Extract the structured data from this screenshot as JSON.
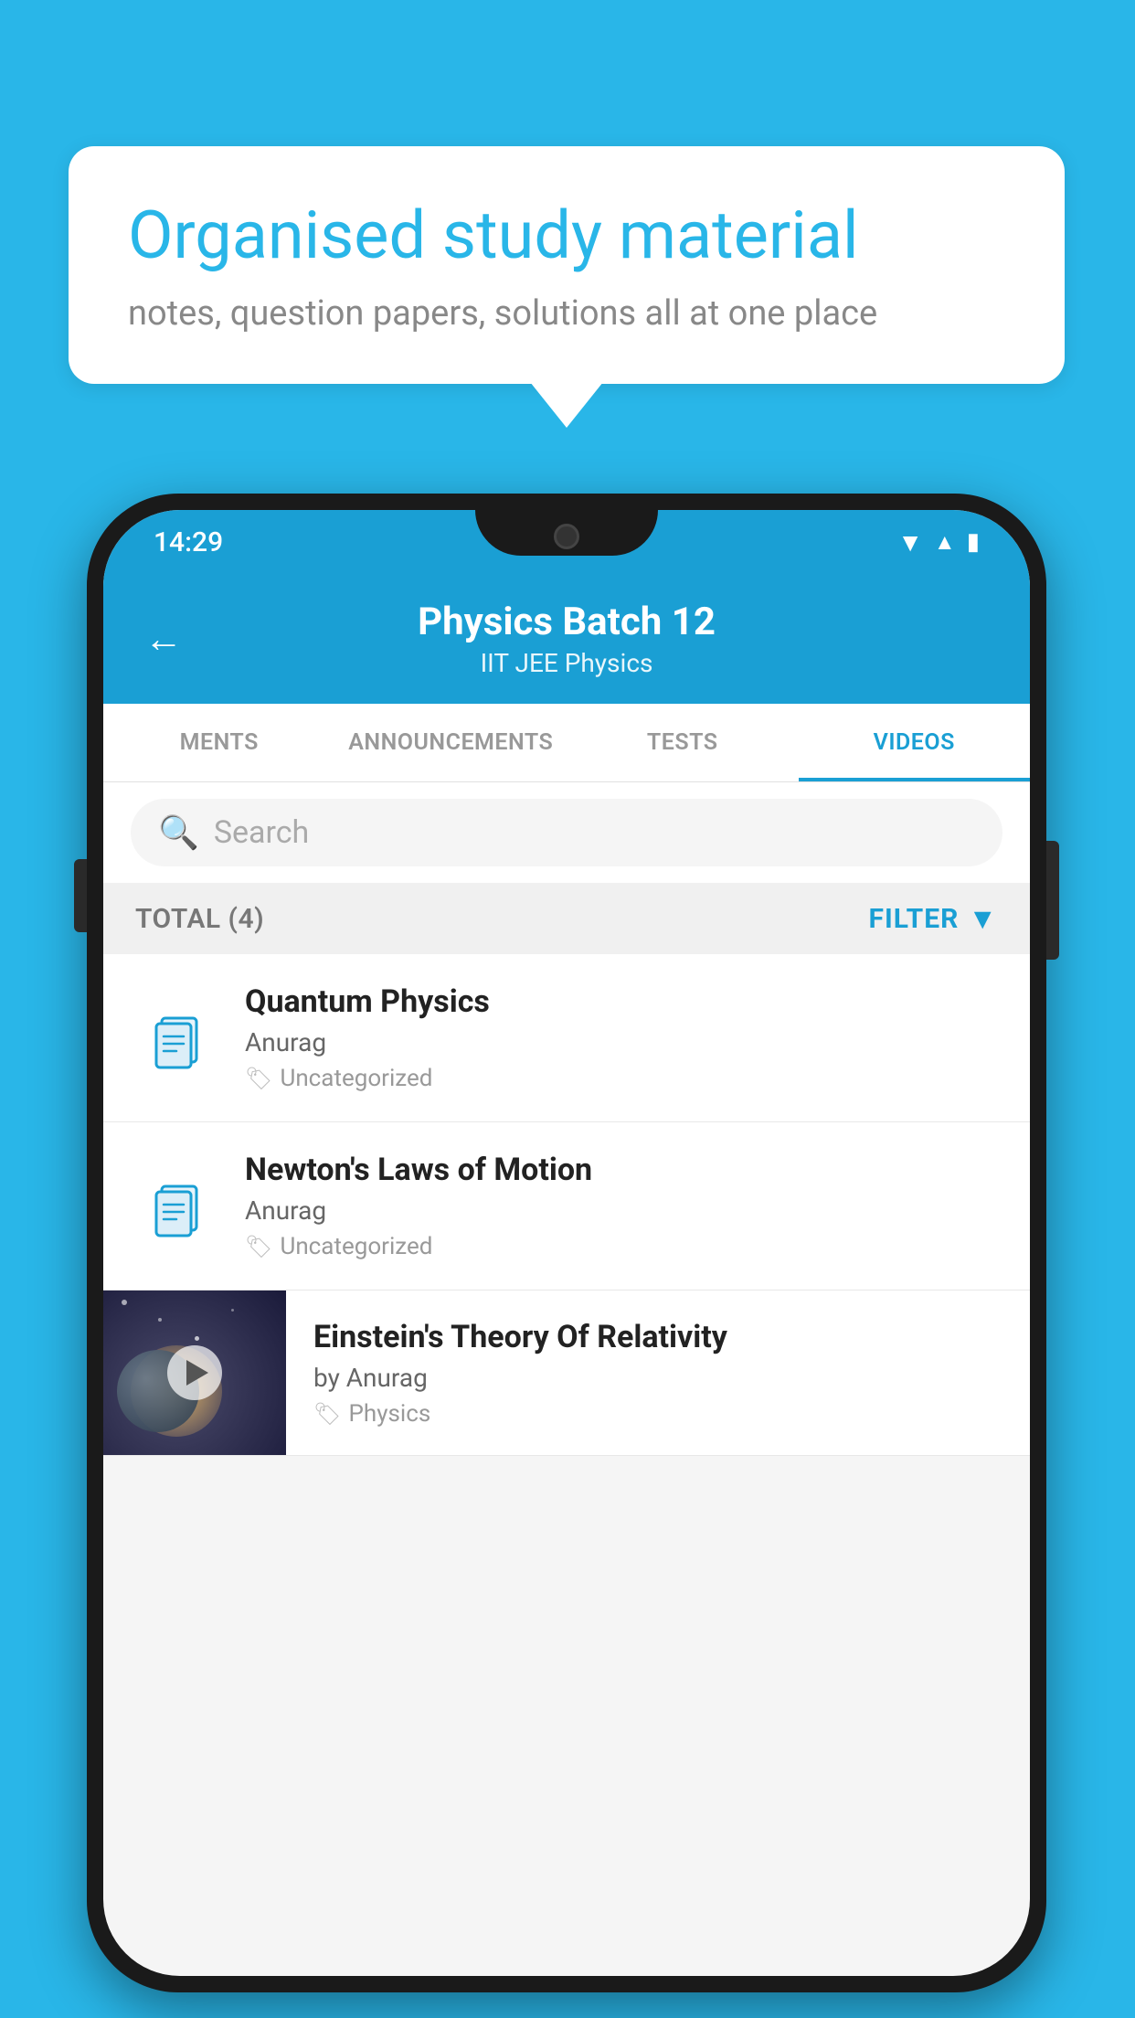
{
  "background": {
    "color": "#29b6e8"
  },
  "speech_bubble": {
    "title": "Organised study material",
    "subtitle": "notes, question papers, solutions all at one place"
  },
  "phone": {
    "status_bar": {
      "time": "14:29"
    },
    "header": {
      "title": "Physics Batch 12",
      "subtitle": "IIT JEE    Physics",
      "back_label": "←"
    },
    "tabs": [
      {
        "label": "MENTS",
        "active": false
      },
      {
        "label": "ANNOUNCEMENTS",
        "active": false
      },
      {
        "label": "TESTS",
        "active": false
      },
      {
        "label": "VIDEOS",
        "active": true
      }
    ],
    "search": {
      "placeholder": "Search"
    },
    "filter_row": {
      "total_label": "TOTAL (4)",
      "filter_label": "FILTER"
    },
    "videos": [
      {
        "id": 1,
        "title": "Quantum Physics",
        "author": "Anurag",
        "tag": "Uncategorized",
        "has_thumbnail": false
      },
      {
        "id": 2,
        "title": "Newton's Laws of Motion",
        "author": "Anurag",
        "tag": "Uncategorized",
        "has_thumbnail": false
      },
      {
        "id": 3,
        "title": "Einstein's Theory Of Relativity",
        "author": "by Anurag",
        "tag": "Physics",
        "has_thumbnail": true
      }
    ]
  }
}
